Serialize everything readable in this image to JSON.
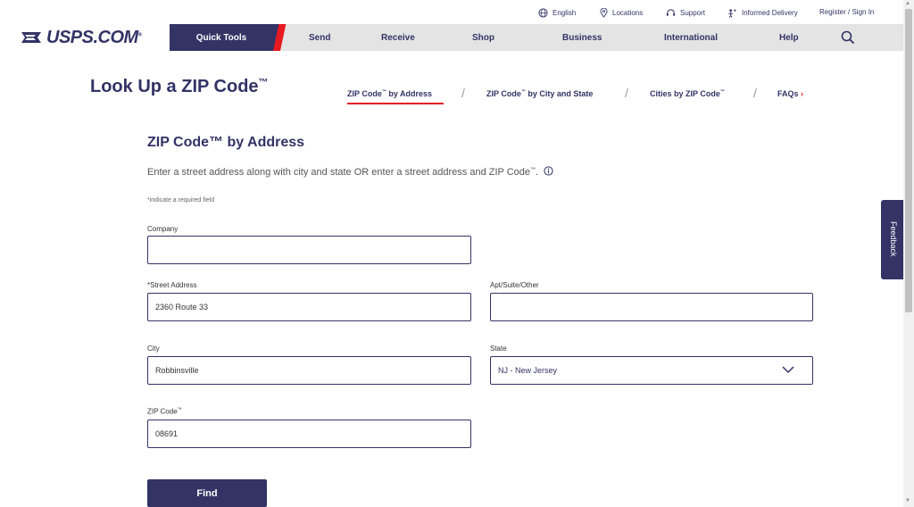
{
  "utility": {
    "english": "English",
    "locations": "Locations",
    "support": "Support",
    "informed_delivery": "Informed Delivery",
    "register": "Register / Sign In"
  },
  "nav": {
    "logo": "USPS.COM",
    "logo_reg": "®",
    "quick_tools": "Quick Tools",
    "send": "Send",
    "receive": "Receive",
    "shop": "Shop",
    "business": "Business",
    "international": "International",
    "help": "Help"
  },
  "page": {
    "title": "Look Up a ZIP Code",
    "title_tm": "™"
  },
  "subnav": {
    "by_address": "ZIP Code",
    "by_address_rest": " by Address",
    "by_city": "ZIP Code",
    "by_city_rest": " by City and State",
    "cities": "Cities by ZIP Code",
    "faqs": "FAQs",
    "tm": "™",
    "separator": "/"
  },
  "form": {
    "section_title": "ZIP Code™ by Address",
    "instruction": "Enter a street address along with city and state OR enter a street address and ZIP Code",
    "instruction_tm": "™",
    "instruction_end": ".",
    "required_note": "*indicate a required field",
    "company_label": "Company",
    "company_value": "",
    "street_label": "*Street Address",
    "street_value": "2360 Route 33",
    "apt_label": "Apt/Suite/Other",
    "apt_value": "",
    "city_label": "City",
    "city_value": "Robbinsville",
    "state_label": "State",
    "state_value": "NJ - New Jersey",
    "zip_label": "ZIP Code",
    "zip_tm": "™",
    "zip_value": "08691",
    "find_button": "Find"
  },
  "feedback": "Feedback",
  "colors": {
    "navy": "#333366",
    "red": "#e71921",
    "nav_bg": "#e4e4e4"
  }
}
